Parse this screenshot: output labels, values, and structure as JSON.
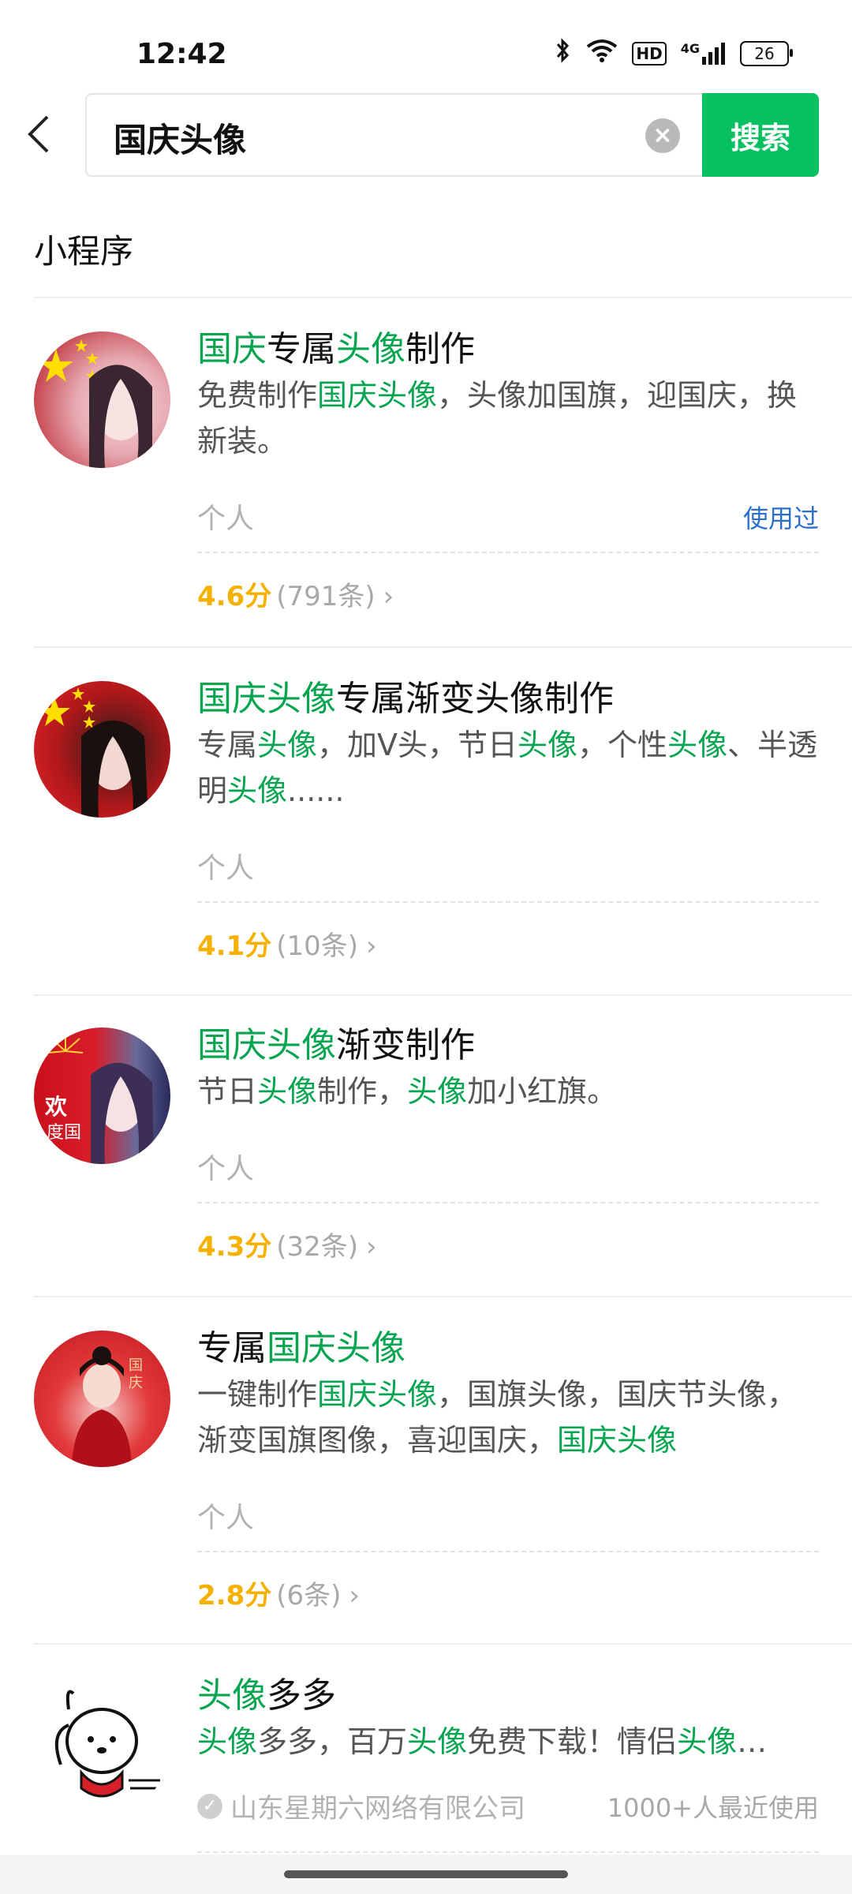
{
  "status_bar": {
    "time": "12:42",
    "bluetooth_icon": "bluetooth-icon",
    "wifi_icon": "wifi-icon",
    "hd_label": "HD",
    "signal_label": "4G",
    "battery": "26"
  },
  "search": {
    "query": "国庆头像",
    "button_label": "搜索"
  },
  "section": {
    "title": "小程序"
  },
  "results": [
    {
      "title_parts": [
        {
          "text": "国庆",
          "hl": true
        },
        {
          "text": "专属",
          "hl": false
        },
        {
          "text": "头像",
          "hl": true
        },
        {
          "text": "制作",
          "hl": false
        }
      ],
      "desc_parts": [
        {
          "text": "免费制作",
          "hl": false
        },
        {
          "text": "国庆头像",
          "hl": true
        },
        {
          "text": "，头像加国旗，迎国庆，换新装。",
          "hl": false
        }
      ],
      "type": "个人",
      "used_label": "使用过",
      "score": "4.6分",
      "count": "(791条)"
    },
    {
      "title_parts": [
        {
          "text": "国庆头像",
          "hl": true
        },
        {
          "text": "专属渐变头像制作",
          "hl": false
        }
      ],
      "desc_parts": [
        {
          "text": "专属",
          "hl": false
        },
        {
          "text": "头像",
          "hl": true
        },
        {
          "text": "，加V头，节日",
          "hl": false
        },
        {
          "text": "头像",
          "hl": true
        },
        {
          "text": "，个性",
          "hl": false
        },
        {
          "text": "头像",
          "hl": true
        },
        {
          "text": "、半透明",
          "hl": false
        },
        {
          "text": "头像",
          "hl": true
        },
        {
          "text": "......",
          "hl": false
        }
      ],
      "type": "个人",
      "score": "4.1分",
      "count": "(10条)"
    },
    {
      "title_parts": [
        {
          "text": "国庆头像",
          "hl": true
        },
        {
          "text": "渐变制作",
          "hl": false
        }
      ],
      "desc_parts": [
        {
          "text": "节日",
          "hl": false
        },
        {
          "text": "头像",
          "hl": true
        },
        {
          "text": "制作，",
          "hl": false
        },
        {
          "text": "头像",
          "hl": true
        },
        {
          "text": "加小红旗。",
          "hl": false
        }
      ],
      "type": "个人",
      "score": "4.3分",
      "count": "(32条)"
    },
    {
      "title_parts": [
        {
          "text": "专属",
          "hl": false
        },
        {
          "text": "国庆头像",
          "hl": true
        }
      ],
      "desc_parts": [
        {
          "text": "一键制作",
          "hl": false
        },
        {
          "text": "国庆头像",
          "hl": true
        },
        {
          "text": "，国旗头像，国庆节头像，渐变国旗图像，喜迎国庆，",
          "hl": false
        },
        {
          "text": "国庆头像",
          "hl": true
        }
      ],
      "type": "个人",
      "score": "2.8分",
      "count": "(6条)"
    },
    {
      "title_parts": [
        {
          "text": "头像",
          "hl": true
        },
        {
          "text": "多多",
          "hl": false
        }
      ],
      "desc_parts": [
        {
          "text": "头像",
          "hl": true
        },
        {
          "text": "多多，百万",
          "hl": false
        },
        {
          "text": "头像",
          "hl": true
        },
        {
          "text": "免费下载！情侣",
          "hl": false
        },
        {
          "text": "头像",
          "hl": true
        },
        {
          "text": "…",
          "hl": false
        }
      ],
      "company": "山东星期六网络有限公司",
      "recent": "1000+人最近使用"
    }
  ]
}
